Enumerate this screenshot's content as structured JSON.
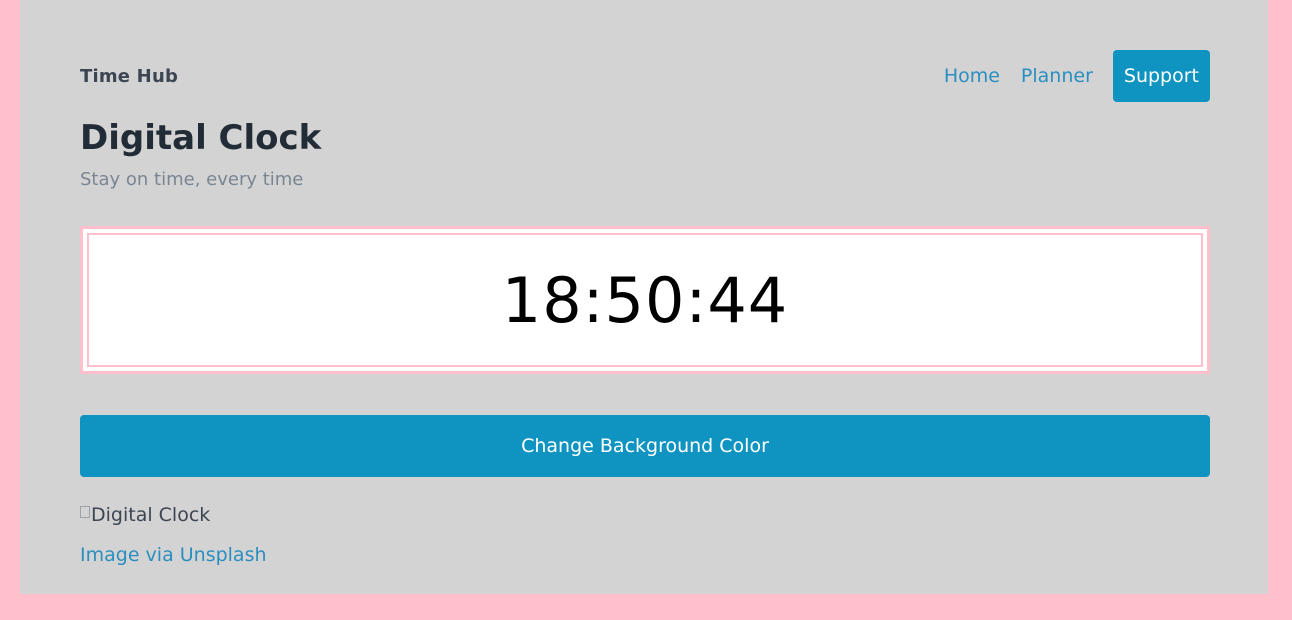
{
  "header": {
    "brand": "Time Hub",
    "nav": {
      "home": "Home",
      "planner": "Planner",
      "support": "Support"
    }
  },
  "page": {
    "title": "Digital Clock",
    "subtitle": "Stay on time, every time"
  },
  "clock": {
    "time": "18:50:44"
  },
  "actions": {
    "change_background": "Change Background Color"
  },
  "image": {
    "alt": "Digital Clock",
    "credit": "Image via Unsplash"
  },
  "colors": {
    "frame": "#ffc0cb",
    "panel": "#d3d3d3",
    "accent": "#0f94c1",
    "link": "#2a8fc0"
  }
}
